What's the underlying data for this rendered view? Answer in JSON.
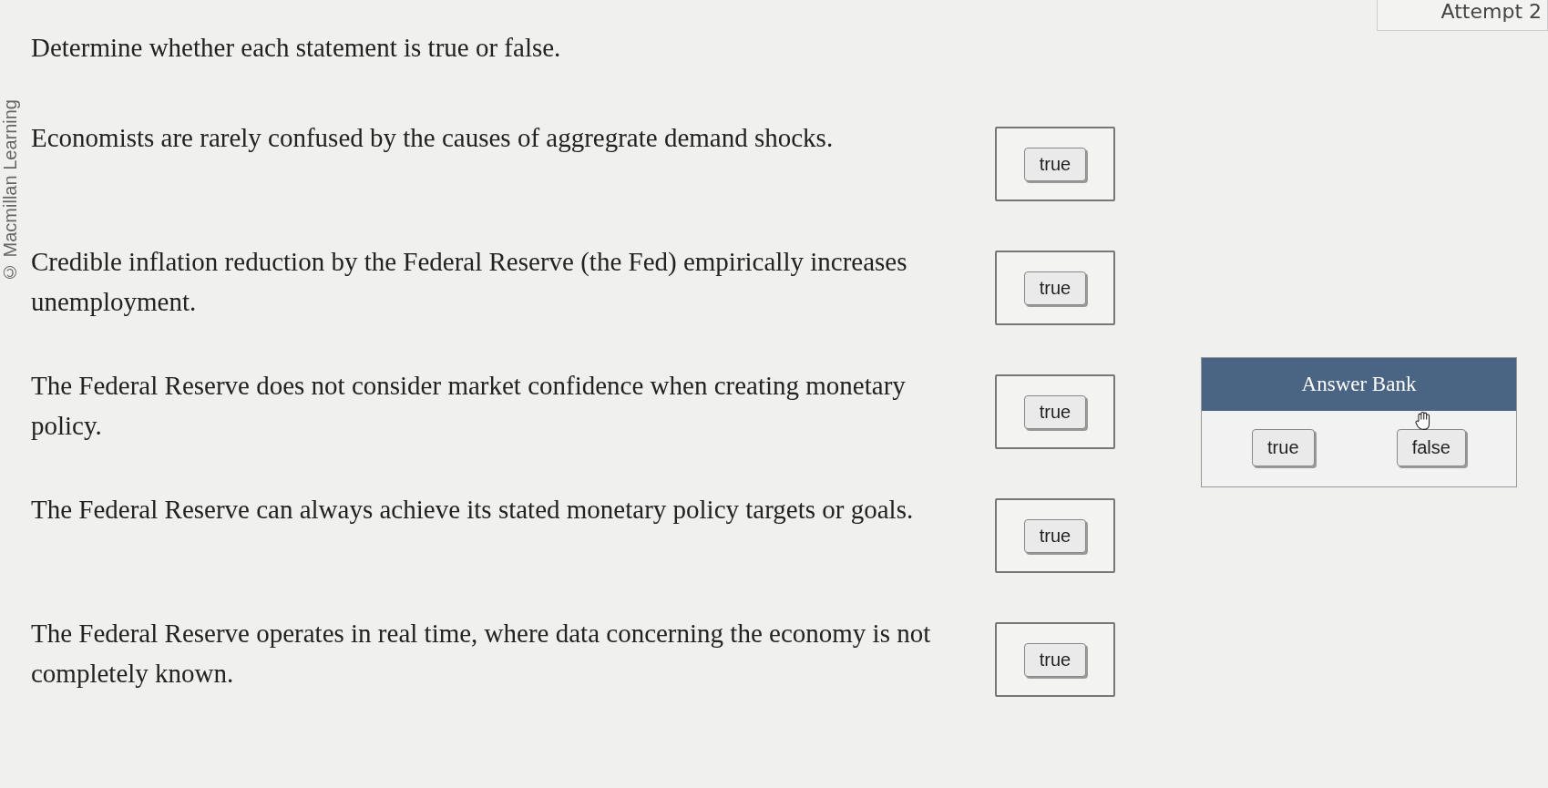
{
  "attempt": "Attempt 2",
  "copyright": "© Macmillan Learning",
  "instruction": "Determine whether each statement is true or false.",
  "statements": [
    {
      "text": "Economists are rarely confused by the causes of aggregrate demand shocks.",
      "answer": "true"
    },
    {
      "text": "Credible inflation reduction by the Federal Reserve (the Fed) empirically increases unemployment.",
      "answer": "true"
    },
    {
      "text": "The Federal Reserve does not consider market confidence when creating monetary policy.",
      "answer": "true"
    },
    {
      "text": "The Federal Reserve can always achieve its stated monetary policy targets or goals.",
      "answer": "true"
    },
    {
      "text": "The Federal Reserve operates in real time, where data concerning the economy is not completely known.",
      "answer": "true"
    }
  ],
  "answer_bank": {
    "title": "Answer Bank",
    "chips": [
      "true",
      "false"
    ]
  }
}
